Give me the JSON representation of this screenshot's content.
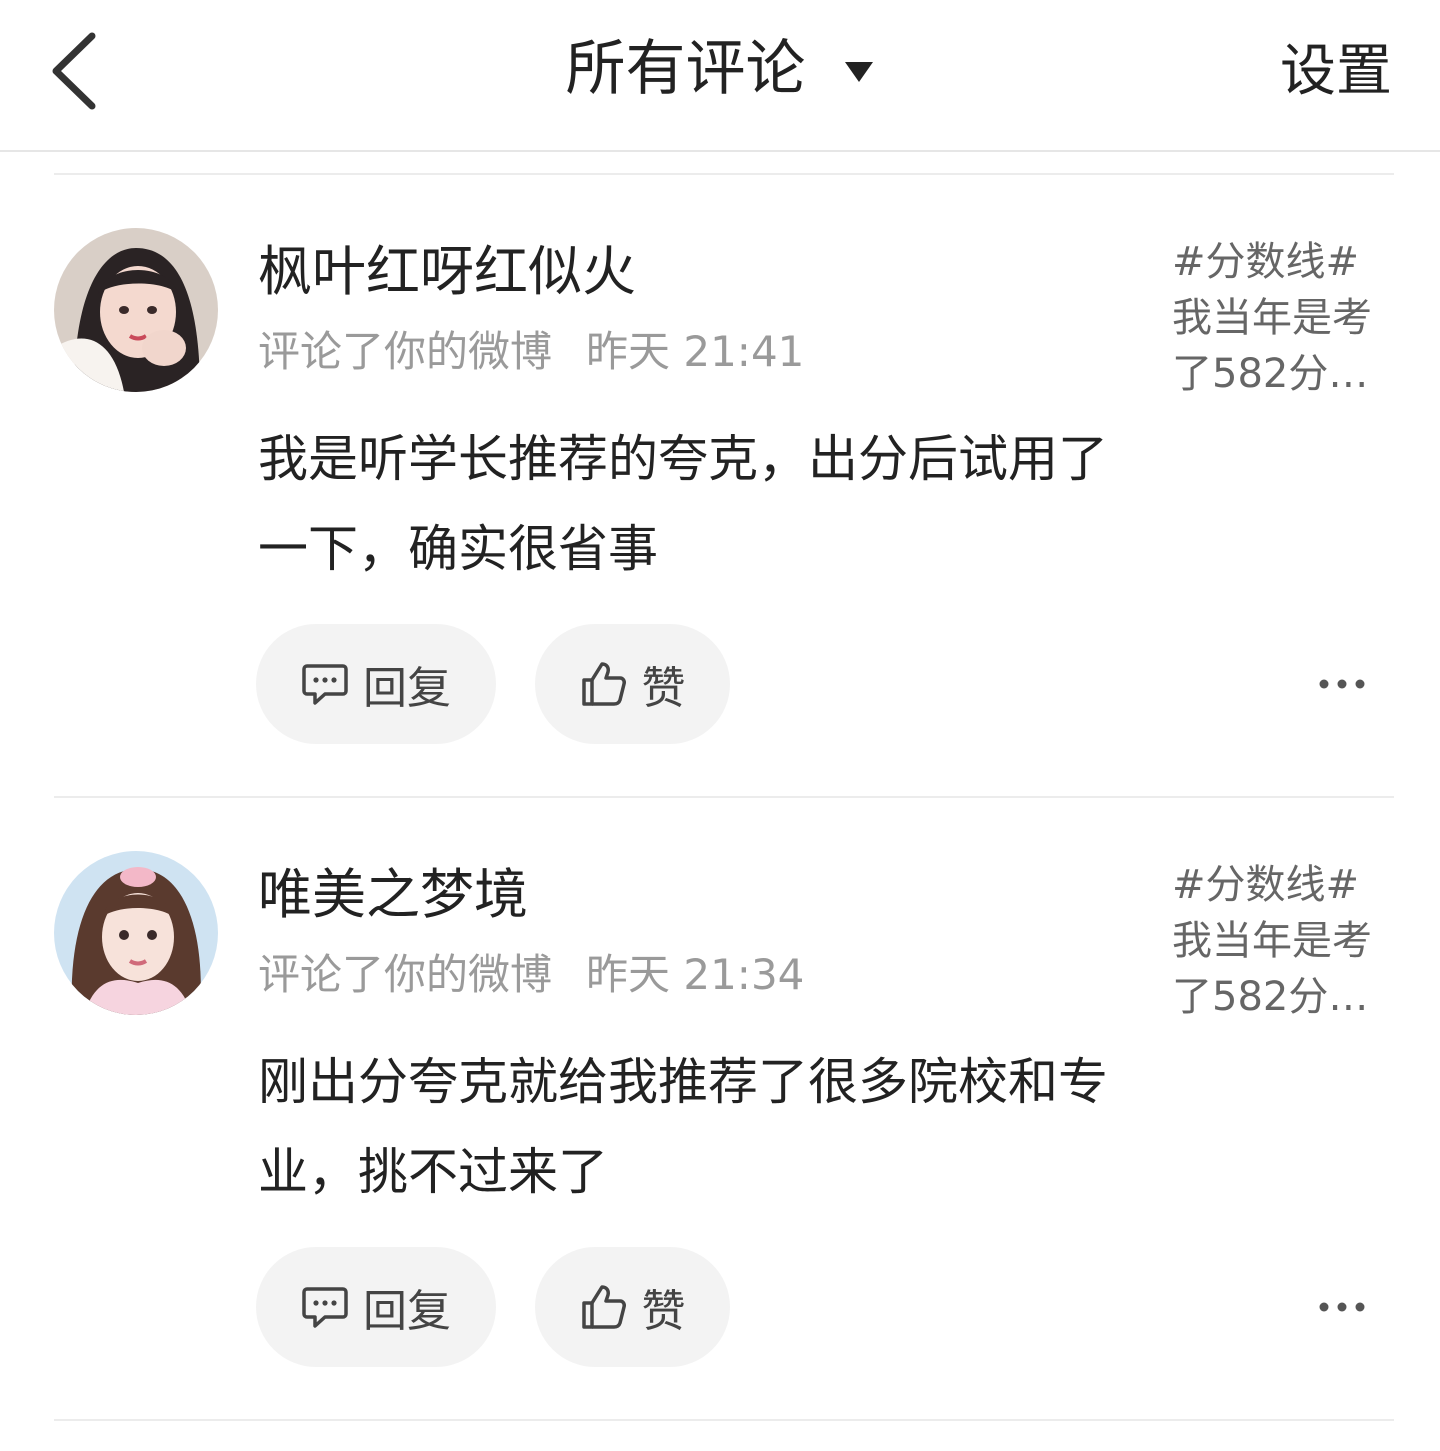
{
  "header": {
    "title": "所有评论",
    "settings_label": "设置"
  },
  "comments": [
    {
      "username": "枫叶红呀红似火",
      "action": "评论了你的微博",
      "time": "昨天 21:41",
      "text": "我是听学长推荐的夸克，出分后试用了一下，确实很省事",
      "topic_line1": "#分数线#",
      "topic_line2": "我当年是考",
      "topic_line3": "了582分…",
      "reply_label": "回复",
      "like_label": "赞"
    },
    {
      "username": "唯美之梦境",
      "action": "评论了你的微博",
      "time": "昨天 21:34",
      "text": "刚出分夸克就给我推荐了很多院校和专业，挑不过来了",
      "topic_line1": "#分数线#",
      "topic_line2": "我当年是考",
      "topic_line3": "了582分…",
      "reply_label": "回复",
      "like_label": "赞"
    }
  ]
}
